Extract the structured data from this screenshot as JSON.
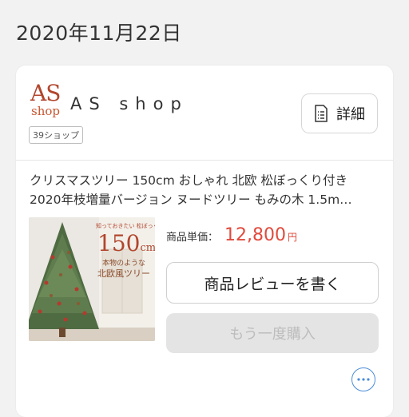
{
  "date": "2020年11月22日",
  "shop": {
    "logo_top": "AS",
    "logo_bottom": "shop",
    "name": "AS shop",
    "badge": "39ショップ",
    "detail_label": "詳細"
  },
  "product": {
    "title_line1": "クリスマスツリー 150cm おしゃれ 北欧 松ぼっくり付き",
    "title_line2": "2020年枝増量バージョン ヌードツリー もみの木 1.5m…",
    "image_text_top": "知っておきたい 松ぼっくり付き",
    "image_size": "150",
    "image_size_unit": "cm",
    "image_text_1": "本物のような",
    "image_text_2": "北欧風ツリー",
    "price_label": "商品単価：",
    "price_value": "12,800",
    "price_unit": "円"
  },
  "actions": {
    "review_label": "商品レビューを書く",
    "rebuy_label": "もう一度購入"
  },
  "colors": {
    "accent": "#e14a3c",
    "logo": "#b2462d",
    "more": "#4a8cd8"
  }
}
